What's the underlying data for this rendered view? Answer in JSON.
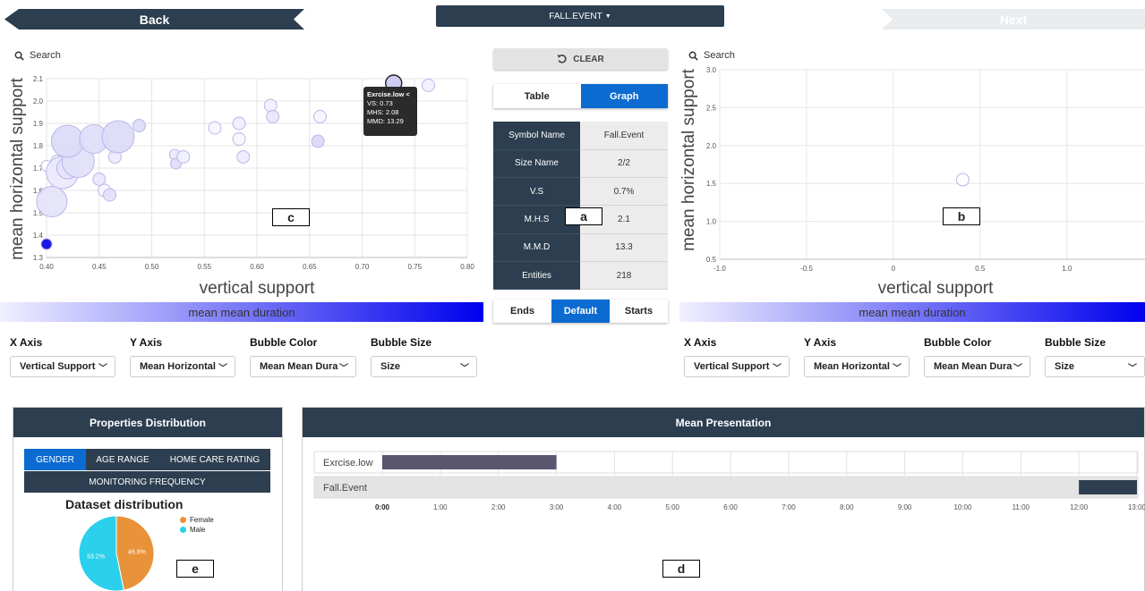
{
  "nav": {
    "back_label": "Back",
    "event_label": "FALL.EVENT",
    "next_label": "Next"
  },
  "left_chart": {
    "search_label": "Search",
    "xlabel": "vertical support",
    "ylabel": "mean horizontal support",
    "color_legend": "mean mean duration",
    "panel_label": "c",
    "x_ticks": [
      "0.40",
      "0.45",
      "0.50",
      "0.55",
      "0.60",
      "0.65",
      "0.70",
      "0.75",
      "0.80"
    ],
    "y_ticks": [
      "2.1",
      "2.0",
      "1.9",
      "1.8",
      "1.7",
      "1.6",
      "1.5",
      "1.4",
      "1.3"
    ],
    "tooltip": {
      "title": "Exrcise.low <",
      "vs": "VS: 0.73",
      "mhs": "MHS: 2.08",
      "mmd": "MMD: 13.29"
    }
  },
  "right_chart": {
    "search_label": "Search",
    "xlabel": "vertical support",
    "ylabel": "mean horizontal support",
    "color_legend": "mean mean duration",
    "panel_label": "b",
    "x_ticks": [
      "-1.0",
      "-0.5",
      "0",
      "0.5",
      "1.0"
    ],
    "y_ticks": [
      "3.0",
      "2.5",
      "2.0",
      "1.5",
      "1.0",
      "0.5"
    ]
  },
  "chart_data": [
    {
      "type": "scatter",
      "xlabel": "vertical support",
      "ylabel": "mean horizontal support",
      "xlim": [
        0.4,
        0.8
      ],
      "ylim": [
        1.3,
        2.1
      ],
      "color_scale": "mean mean duration",
      "points": [
        {
          "x": 0.4,
          "y": 1.36,
          "r": 6,
          "fill": "#0000e0"
        },
        {
          "x": 0.4,
          "y": 1.71,
          "r": 6,
          "fill": "#ffffff"
        },
        {
          "x": 0.405,
          "y": 1.55,
          "r": 17,
          "fill": "#e4e2fa"
        },
        {
          "x": 0.41,
          "y": 1.73,
          "r": 7,
          "fill": "#f4f3ff"
        },
        {
          "x": 0.415,
          "y": 1.68,
          "r": 18,
          "fill": "#eae8fc"
        },
        {
          "x": 0.42,
          "y": 1.7,
          "r": 12,
          "fill": "#e6e4fb"
        },
        {
          "x": 0.43,
          "y": 1.73,
          "r": 18,
          "fill": "#e2e0fa"
        },
        {
          "x": 0.42,
          "y": 1.82,
          "r": 18,
          "fill": "#dcdaf8"
        },
        {
          "x": 0.445,
          "y": 1.83,
          "r": 16,
          "fill": "#e0defa"
        },
        {
          "x": 0.45,
          "y": 1.65,
          "r": 7,
          "fill": "#e8e6fc"
        },
        {
          "x": 0.455,
          "y": 1.6,
          "r": 7,
          "fill": "#f6f5ff"
        },
        {
          "x": 0.46,
          "y": 1.58,
          "r": 7,
          "fill": "#e2e0f8"
        },
        {
          "x": 0.465,
          "y": 1.75,
          "r": 7,
          "fill": "#eceafd"
        },
        {
          "x": 0.468,
          "y": 1.84,
          "r": 18,
          "fill": "#dcdaf8"
        },
        {
          "x": 0.488,
          "y": 1.89,
          "r": 7,
          "fill": "#dddbf8"
        },
        {
          "x": 0.522,
          "y": 1.76,
          "r": 6,
          "fill": "#eae9fc"
        },
        {
          "x": 0.523,
          "y": 1.72,
          "r": 6,
          "fill": "#dedcf8"
        },
        {
          "x": 0.53,
          "y": 1.75,
          "r": 7,
          "fill": "#f0efff"
        },
        {
          "x": 0.56,
          "y": 1.88,
          "r": 7,
          "fill": "#f6f5ff"
        },
        {
          "x": 0.583,
          "y": 1.9,
          "r": 7,
          "fill": "#eeedfd"
        },
        {
          "x": 0.583,
          "y": 1.83,
          "r": 7,
          "fill": "#f6f5ff"
        },
        {
          "x": 0.587,
          "y": 1.75,
          "r": 7,
          "fill": "#eceafd"
        },
        {
          "x": 0.613,
          "y": 1.98,
          "r": 7,
          "fill": "#f0efff"
        },
        {
          "x": 0.615,
          "y": 1.93,
          "r": 7,
          "fill": "#e8e6fc"
        },
        {
          "x": 0.658,
          "y": 1.82,
          "r": 7,
          "fill": "#d9d7f8"
        },
        {
          "x": 0.66,
          "y": 1.93,
          "r": 7,
          "fill": "#f6f5ff"
        },
        {
          "x": 0.73,
          "y": 2.08,
          "r": 9,
          "fill": "#c9c6f4"
        },
        {
          "x": 0.763,
          "y": 2.07,
          "r": 7,
          "fill": "#f0efff"
        }
      ]
    },
    {
      "type": "scatter",
      "xlabel": "vertical support",
      "ylabel": "mean horizontal support",
      "xlim": [
        -1.0,
        1.45
      ],
      "ylim": [
        0.5,
        3.0
      ],
      "points": [
        {
          "x": 0.4,
          "y": 1.55,
          "r": 7,
          "fill": "#ffffff"
        }
      ]
    }
  ],
  "center": {
    "clear_label": "CLEAR",
    "view_tabs": [
      {
        "label": "Table",
        "active": false
      },
      {
        "label": "Graph",
        "active": true
      }
    ],
    "rows": [
      {
        "key": "Symbol Name",
        "value": "Fall.Event"
      },
      {
        "key": "Size Name",
        "value": "2/2"
      },
      {
        "key": "V.S",
        "value": "0.7%"
      },
      {
        "key": "M.H.S",
        "value": "2.1"
      },
      {
        "key": "M.M.D",
        "value": "13.3"
      },
      {
        "key": "Entities",
        "value": "218"
      }
    ],
    "panel_label": "a",
    "align_tabs": [
      {
        "label": "Ends",
        "active": false
      },
      {
        "label": "Default",
        "active": true
      },
      {
        "label": "Starts",
        "active": false
      }
    ]
  },
  "left_controls": {
    "x_axis": {
      "label": "X Axis",
      "value": "Vertical Support"
    },
    "y_axis": {
      "label": "Y Axis",
      "value": "Mean Horizontal"
    },
    "bubble_color": {
      "label": "Bubble Color",
      "value": "Mean Mean Dura"
    },
    "bubble_size": {
      "label": "Bubble Size",
      "value": "Size"
    }
  },
  "right_controls": {
    "x_axis": {
      "label": "X Axis",
      "value": "Vertical Support"
    },
    "y_axis": {
      "label": "Y Axis",
      "value": "Mean Horizontal"
    },
    "bubble_color": {
      "label": "Bubble Color",
      "value": "Mean Mean Dura"
    },
    "bubble_size": {
      "label": "Bubble Size",
      "value": "Size"
    }
  },
  "properties": {
    "title": "Properties Distribution",
    "tabs": [
      "GENDER",
      "AGE RANGE",
      "HOME CARE RATING",
      "MONITORING FREQUENCY"
    ],
    "active_tab": "GENDER",
    "chart_title": "Dataset distribution",
    "legend": [
      {
        "name": "Female",
        "color": "#e8923a"
      },
      {
        "name": "Male",
        "color": "#2ad0ec"
      }
    ],
    "slices": [
      {
        "name": "Female",
        "percent": 46.8,
        "label": "46.8%"
      },
      {
        "name": "Male",
        "percent": 53.2,
        "label": "53.2%"
      }
    ],
    "panel_label": "e"
  },
  "mean_presentation": {
    "title": "Mean Presentation",
    "rows": [
      {
        "label": "Exrcise.low",
        "start": 0,
        "end": 3.0,
        "color": "#5a5670"
      },
      {
        "label": "Fall.Event",
        "start": 12.0,
        "end": 13.0,
        "color": "#2c3e50"
      }
    ],
    "ticks": [
      "0:00",
      "1:00",
      "2:00",
      "3:00",
      "4:00",
      "5:00",
      "6:00",
      "7:00",
      "8:00",
      "9:00",
      "10:00",
      "11:00",
      "12:00",
      "13:00"
    ],
    "panel_label": "d"
  },
  "colors": {
    "navy": "#2c3e50",
    "active_blue": "#0b6bd0",
    "bubble_dark": "#0000e0"
  }
}
